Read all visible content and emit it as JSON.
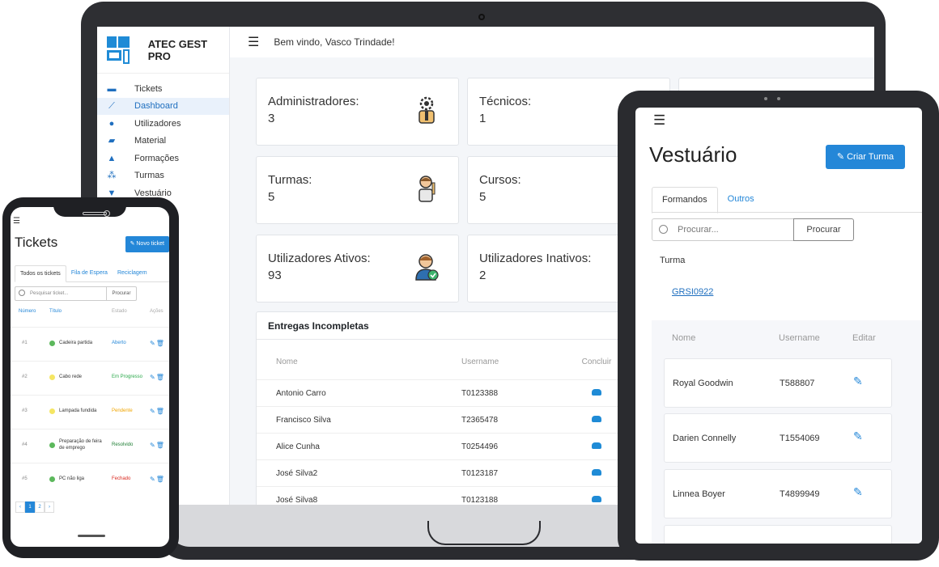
{
  "laptop": {
    "brand": "ATEC GEST PRO",
    "welcome": "Bem vindo, Vasco Trindade!",
    "nav": [
      {
        "label": "Tickets",
        "active": false
      },
      {
        "label": "Dashboard",
        "active": true
      },
      {
        "label": "Utilizadores",
        "active": false
      },
      {
        "label": "Material",
        "active": false
      },
      {
        "label": "Formações",
        "active": false
      },
      {
        "label": "Turmas",
        "active": false
      },
      {
        "label": "Vestuário",
        "active": false
      }
    ],
    "stats": [
      {
        "label": "Administradores:",
        "value": "3"
      },
      {
        "label": "Técnicos:",
        "value": "1"
      },
      {
        "label": "Turmas:",
        "value": "5"
      },
      {
        "label": "Cursos:",
        "value": "5"
      },
      {
        "label": "Utilizadores Ativos:",
        "value": "93"
      },
      {
        "label": "Utilizadores Inativos:",
        "value": "2"
      }
    ],
    "table": {
      "title": "Entregas Incompletas",
      "headers": [
        "Nome",
        "Username",
        "Concluir"
      ],
      "rows": [
        {
          "name": "Antonio Carro",
          "username": "T0123388"
        },
        {
          "name": "Francisco Silva",
          "username": "T2365478"
        },
        {
          "name": "Alice Cunha",
          "username": "T0254496"
        },
        {
          "name": "José Silva2",
          "username": "T0123187"
        },
        {
          "name": "José Silva8",
          "username": "T0123188"
        }
      ]
    }
  },
  "phone": {
    "title": "Tickets",
    "new_button": "Novo ticket",
    "tabs": [
      "Todos os tickets",
      "Fila de Espera",
      "Reciclagem"
    ],
    "search_placeholder": "Pesquisar ticket...",
    "search_button": "Procurar",
    "headers": [
      "Número",
      "Título",
      "Estado",
      "Ações"
    ],
    "rows": [
      {
        "num": "#1",
        "title": "Cadeira partida",
        "status": "Aberto",
        "dot": "#5cb85c",
        "status_color": "#2487d8"
      },
      {
        "num": "#2",
        "title": "Cabo rede",
        "status": "Em Progresso",
        "dot": "#f5e663",
        "status_color": "#2aa84a"
      },
      {
        "num": "#3",
        "title": "Lampada fundida",
        "status": "Pendente",
        "dot": "#f5e663",
        "status_color": "#f0a500"
      },
      {
        "num": "#4",
        "title": "Preparação de feira de emprego",
        "status": "Resolvido",
        "dot": "#5cb85c",
        "status_color": "#1e7e34"
      },
      {
        "num": "#5",
        "title": "PC não liga",
        "status": "Fechado",
        "dot": "#5cb85c",
        "status_color": "#d9261c"
      }
    ],
    "pages": [
      "‹",
      "1",
      "2",
      "›"
    ]
  },
  "tablet": {
    "title": "Vestuário",
    "create_button": "Criar Turma",
    "tabs": [
      "Formandos",
      "Outros"
    ],
    "search_placeholder": "Procurar...",
    "search_button": "Procurar",
    "turma_label": "Turma",
    "turma_link": "GRSI0922",
    "headers": [
      "Nome",
      "Username",
      "Editar"
    ],
    "rows": [
      {
        "name": "Royal Goodwin",
        "username": "T588807"
      },
      {
        "name": "Darien Connelly",
        "username": "T1554069"
      },
      {
        "name": "Linnea Boyer",
        "username": "T4899949"
      }
    ]
  },
  "colors": {
    "accent": "#2487d8",
    "device_frame": "#2e2f33"
  }
}
